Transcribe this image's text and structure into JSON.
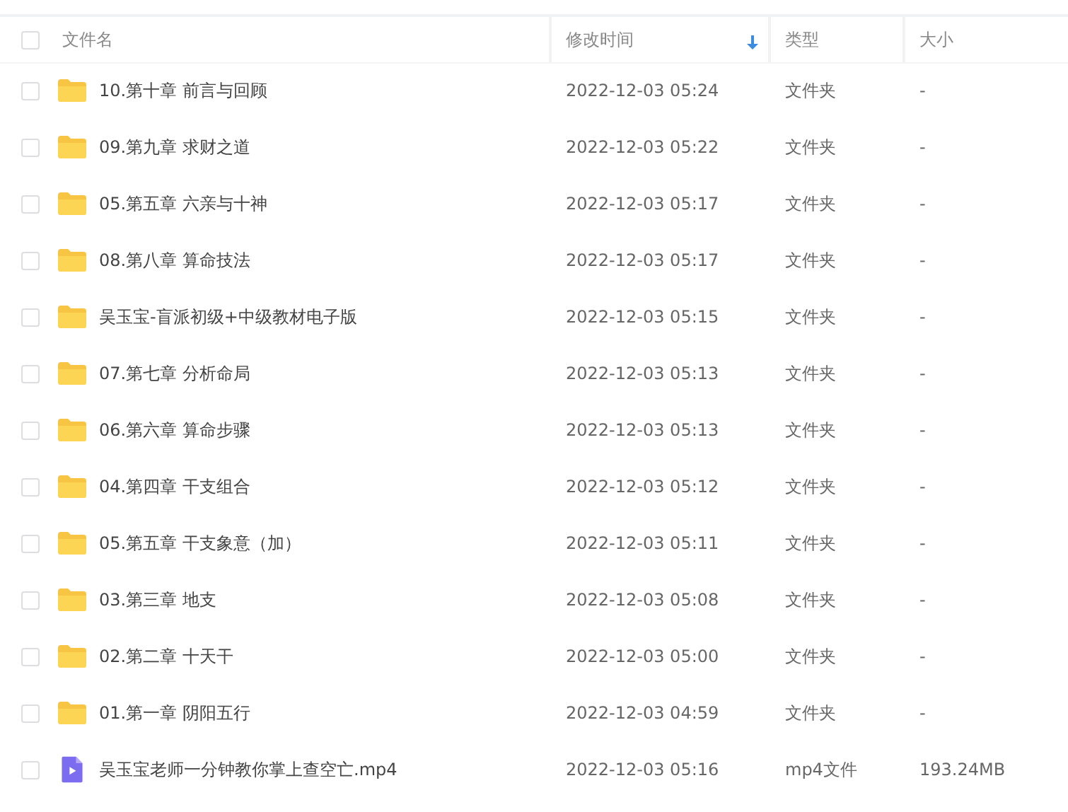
{
  "table": {
    "select_all": {
      "checked": false
    },
    "columns": [
      {
        "label": "文件名",
        "sorted": false
      },
      {
        "label": "修改时间",
        "sorted": true
      },
      {
        "label": "类型",
        "sorted": false
      },
      {
        "label": "大小",
        "sorted": false
      }
    ],
    "rows": [
      {
        "kind": "folder",
        "checked": false,
        "name": "10.第十章 前言与回顾",
        "modified": "2022-12-03 05:24",
        "type": "文件夹",
        "size": "-"
      },
      {
        "kind": "folder",
        "checked": false,
        "name": "09.第九章 求财之道",
        "modified": "2022-12-03 05:22",
        "type": "文件夹",
        "size": "-"
      },
      {
        "kind": "folder",
        "checked": false,
        "name": "05.第五章  六亲与十神",
        "modified": "2022-12-03 05:17",
        "type": "文件夹",
        "size": "-"
      },
      {
        "kind": "folder",
        "checked": false,
        "name": "08.第八章  算命技法",
        "modified": "2022-12-03 05:17",
        "type": "文件夹",
        "size": "-"
      },
      {
        "kind": "folder",
        "checked": false,
        "name": "吴玉宝-盲派初级+中级教材电子版",
        "modified": "2022-12-03 05:15",
        "type": "文件夹",
        "size": "-"
      },
      {
        "kind": "folder",
        "checked": false,
        "name": "07.第七章 分析命局",
        "modified": "2022-12-03 05:13",
        "type": "文件夹",
        "size": "-"
      },
      {
        "kind": "folder",
        "checked": false,
        "name": "06.第六章 算命步骤",
        "modified": "2022-12-03 05:13",
        "type": "文件夹",
        "size": "-"
      },
      {
        "kind": "folder",
        "checked": false,
        "name": "04.第四章 干支组合",
        "modified": "2022-12-03 05:12",
        "type": "文件夹",
        "size": "-"
      },
      {
        "kind": "folder",
        "checked": false,
        "name": "05.第五章 干支象意（加）",
        "modified": "2022-12-03 05:11",
        "type": "文件夹",
        "size": "-"
      },
      {
        "kind": "folder",
        "checked": false,
        "name": "03.第三章 地支",
        "modified": "2022-12-03 05:08",
        "type": "文件夹",
        "size": "-"
      },
      {
        "kind": "folder",
        "checked": false,
        "name": "02.第二章 十天干",
        "modified": "2022-12-03 05:00",
        "type": "文件夹",
        "size": "-"
      },
      {
        "kind": "folder",
        "checked": false,
        "name": "01.第一章 阴阳五行",
        "modified": "2022-12-03 04:59",
        "type": "文件夹",
        "size": "-"
      },
      {
        "kind": "video",
        "checked": false,
        "name": "吴玉宝老师一分钟教你掌上查空亡.mp4",
        "modified": "2022-12-03 05:16",
        "type": "mp4文件",
        "size": "193.24MB"
      }
    ]
  }
}
